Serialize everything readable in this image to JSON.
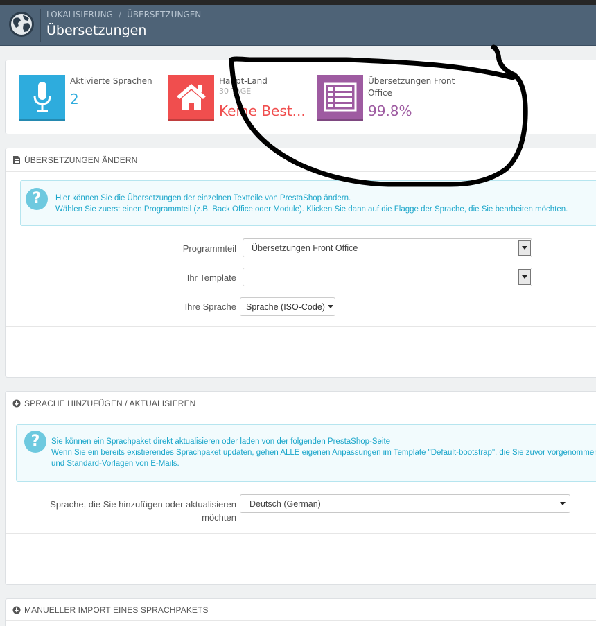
{
  "header": {
    "breadcrumb": [
      "LOKALISIERUNG",
      "ÜBERSETZUNGEN"
    ],
    "breadcrumb_sep": "/",
    "title": "Übersetzungen",
    "logo_icon": "globe-icon"
  },
  "kpis": [
    {
      "title": "Aktivierte Sprachen",
      "subtitle": "",
      "value": "2",
      "icon": "microphone-icon",
      "color": "#2eacdd"
    },
    {
      "title": "Haupt-Land",
      "subtitle": "30 TAGE",
      "value": "Keine Best...",
      "icon": "home-icon",
      "color": "#f04e4e"
    },
    {
      "title": "Übersetzungen Front",
      "title2": "Office",
      "subtitle": "",
      "value": "99.8%",
      "icon": "list-icon",
      "color": "#9e5ba1"
    }
  ],
  "panel_edit": {
    "heading": "ÜBERSETZUNGEN ÄNDERN",
    "alert_lines": [
      "Hier können Sie die Übersetzungen der einzelnen Textteile von PrestaShop ändern.",
      "Wählen Sie zuerst einen Programmteil (z.B. Back Office oder Module). Klicken Sie dann auf die Flagge der Sprache, die Sie bearbeiten möchten."
    ],
    "fields": {
      "programmteil_label": "Programmteil",
      "programmteil_value": "Übersetzungen Front Office",
      "template_label": "Ihr Template",
      "template_value": "",
      "sprache_label": "Ihre Sprache",
      "sprache_value": "Sprache (ISO-Code)"
    }
  },
  "panel_add": {
    "heading": "SPRACHE HINZUFÜGEN / AKTUALISIEREN",
    "alert_lines": [
      "Sie können ein Sprachpaket direkt aktualisieren oder laden von der folgenden PrestaShop-Seite",
      "Wenn Sie ein bereits existierendes Sprachpaket updaten, gehen ALLE eigenen Anpassungen im Template \"Default-bootstrap\", die Sie zuvor vorgenommen haben,",
      "und Standard-Vorlagen von E-Mails."
    ],
    "language_label_1": "Sprache, die Sie hinzufügen oder aktualisieren",
    "language_label_2": "möchten",
    "language_value": "Deutsch (German)"
  },
  "panel_import": {
    "heading": "MANUELLER IMPORT EINES SPRACHPAKETS"
  },
  "colors": {
    "header_bg": "#4e6377",
    "alert_text": "#1ba6ca",
    "kpi_blue": "#2eacdd",
    "kpi_red": "#f04e4e",
    "kpi_purple": "#9e5ba1"
  }
}
